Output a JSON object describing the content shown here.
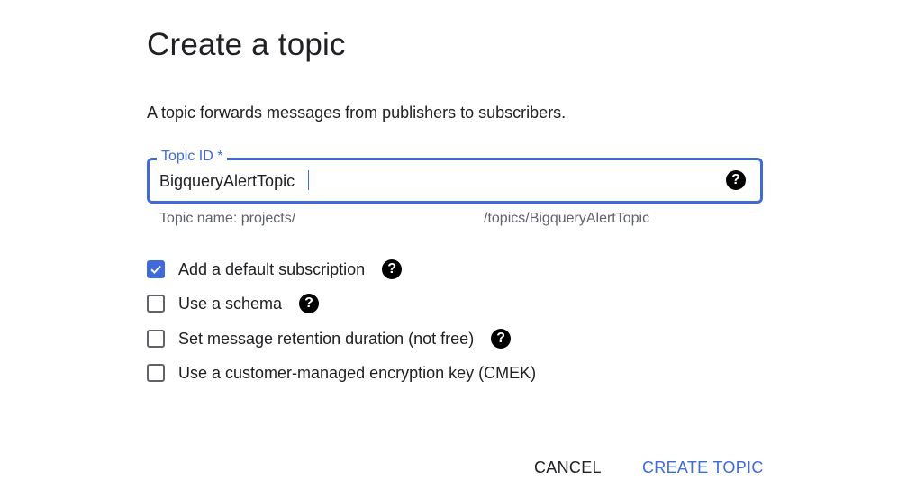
{
  "dialog": {
    "title": "Create a topic",
    "description": "A topic forwards messages from publishers to subscribers."
  },
  "topic_field": {
    "label": "Topic ID *",
    "value": "BigqueryAlertTopic",
    "help_icon": "help-icon",
    "hint_prefix": "Topic name: projects/",
    "hint_suffix": "/topics/BigqueryAlertTopic"
  },
  "options": [
    {
      "label": "Add a default subscription",
      "checked": true,
      "has_help": true
    },
    {
      "label": "Use a schema",
      "checked": false,
      "has_help": true
    },
    {
      "label": "Set message retention duration (not free)",
      "checked": false,
      "has_help": true
    },
    {
      "label": "Use a customer-managed encryption key (CMEK)",
      "checked": false,
      "has_help": false
    }
  ],
  "actions": {
    "cancel_label": "CANCEL",
    "create_label": "CREATE TOPIC"
  },
  "colors": {
    "accent": "#3f6ad8",
    "text": "#202124",
    "secondary_text": "#5f6368"
  }
}
